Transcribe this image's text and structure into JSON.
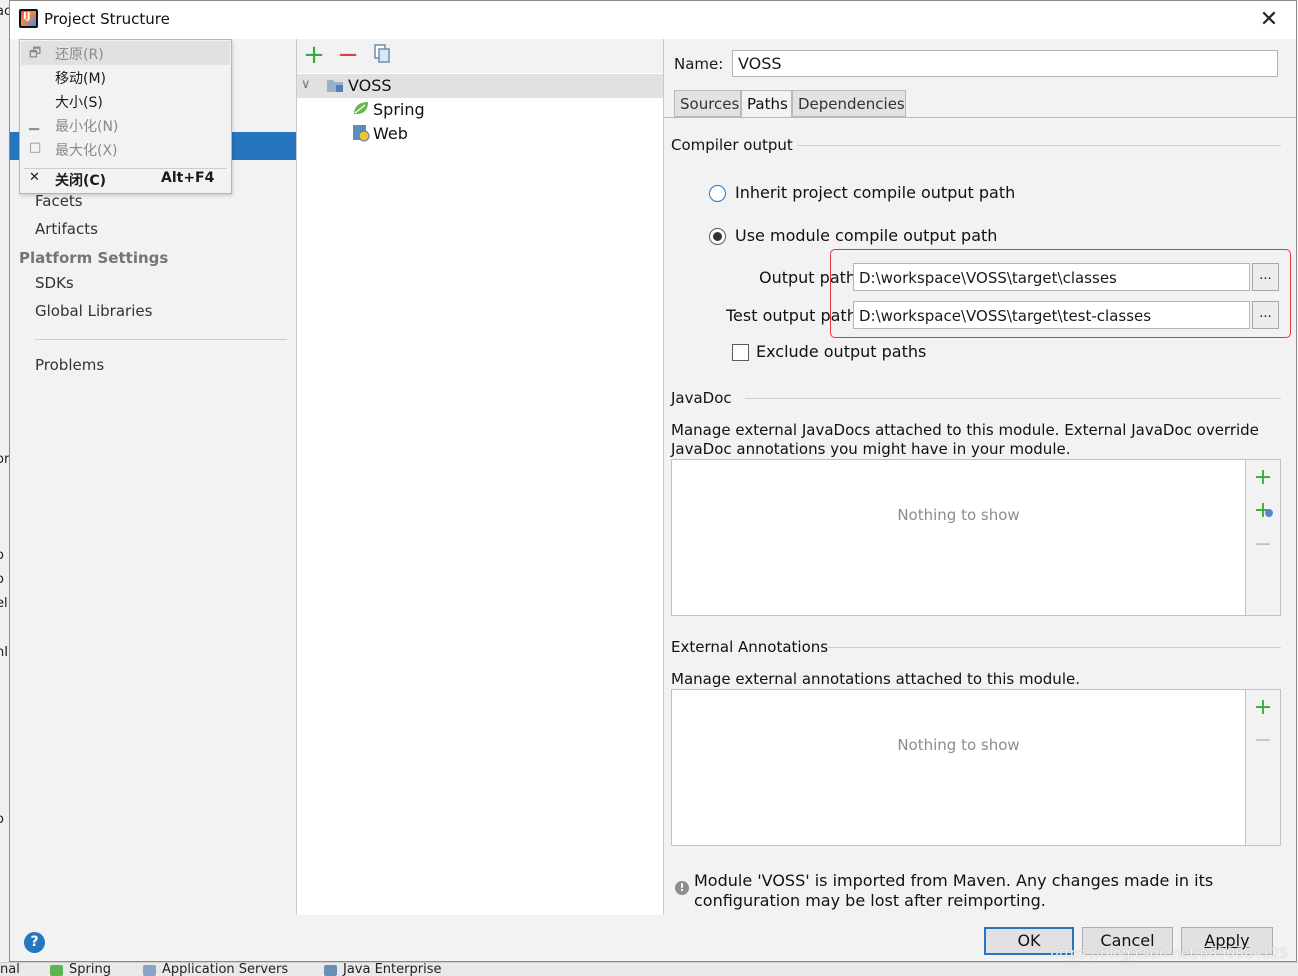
{
  "window": {
    "title": "Project Structure"
  },
  "system_menu": {
    "items": [
      {
        "label": "还原(R)",
        "icon": "restore-icon",
        "enabled": false
      },
      {
        "label": "移动(M)",
        "icon": "",
        "enabled": true
      },
      {
        "label": "大小(S)",
        "icon": "",
        "enabled": true
      },
      {
        "label": "最小化(N)",
        "icon": "minimize-icon",
        "enabled": false
      },
      {
        "label": "最大化(X)",
        "icon": "maximize-icon",
        "enabled": false
      },
      {
        "label": "关闭(C)",
        "icon": "close-icon",
        "shortcut": "Alt+F4",
        "enabled": true
      }
    ]
  },
  "left_nav": {
    "items_top": [
      "Facets",
      "Artifacts"
    ],
    "platform_header": "Platform Settings",
    "platform_items": [
      "SDKs",
      "Global Libraries"
    ],
    "bottom_items": [
      "Problems"
    ]
  },
  "module_tree": {
    "root": "VOSS",
    "children": [
      "Spring",
      "Web"
    ]
  },
  "module": {
    "name_label": "Name:",
    "name_value": "VOSS",
    "tabs": [
      "Sources",
      "Paths",
      "Dependencies"
    ],
    "active_tab": "Paths"
  },
  "compiler_output": {
    "title": "Compiler output",
    "option_inherit": "Inherit project compile output path",
    "option_use_module": "Use module compile output path",
    "selected": "use_module",
    "output_path_label": "Output path:",
    "output_path_value": "D:\\workspace\\VOSS\\target\\classes",
    "test_output_path_label": "Test output path:",
    "test_output_path_value": "D:\\workspace\\VOSS\\target\\test-classes",
    "browse_label": "...",
    "exclude_label": "Exclude output paths",
    "exclude_checked": false
  },
  "javadoc": {
    "title": "JavaDoc",
    "description": "Manage external JavaDocs attached to this module. External JavaDoc override JavaDoc annotations you might have in your module.",
    "empty_text": "Nothing to show"
  },
  "external_annotations": {
    "title": "External Annotations",
    "description": "Manage external annotations attached to this module.",
    "empty_text": "Nothing to show"
  },
  "info_message": "Module 'VOSS' is imported from Maven. Any changes made in its configuration may be lost after reimporting.",
  "footer": {
    "help": "?",
    "ok": "OK",
    "cancel": "Cancel",
    "apply": "Apply"
  },
  "background_strip": {
    "left_chars": [
      "ac",
      "or",
      "o",
      "o",
      "el",
      "nI",
      "o"
    ],
    "bottom_items": [
      "nal",
      "Spring",
      "Application Servers",
      "Java Enterprise"
    ]
  },
  "watermark": "https://blog.csdn.net/a890884125",
  "colors": {
    "accent": "#2675bf",
    "highlight_box": "#e0393e",
    "green_action": "#35a83b"
  }
}
